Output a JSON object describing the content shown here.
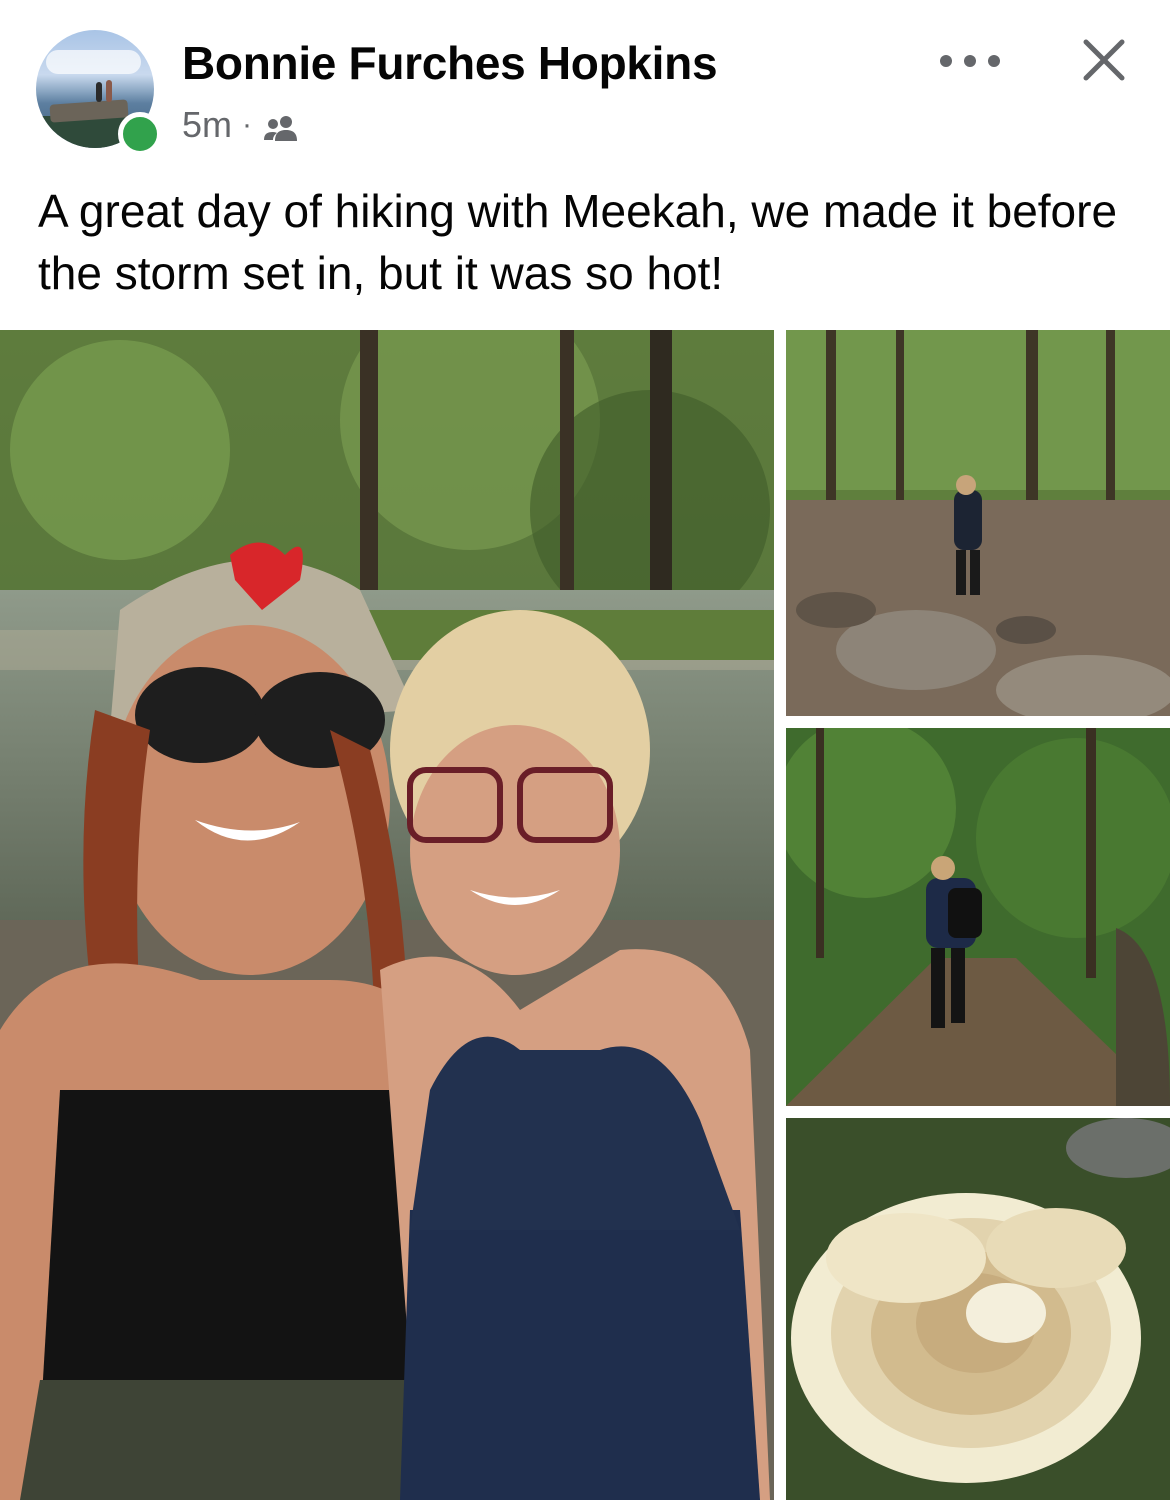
{
  "post": {
    "author": "Bonnie Furches Hopkins",
    "time": "5m",
    "separator": "·",
    "audience_icon": "friends-icon",
    "online": true,
    "caption": "A great day of hiking with Meekah, we made it before the storm set in, but it was so hot!"
  },
  "actions": {
    "more_icon": "more-options-icon",
    "close_icon": "close-icon"
  },
  "photos": [
    {
      "id": "selfie",
      "icon": "photo"
    },
    {
      "id": "rocky-creek-trail",
      "icon": "photo"
    },
    {
      "id": "forest-path",
      "icon": "photo"
    },
    {
      "id": "mushroom",
      "icon": "photo"
    }
  ],
  "colors": {
    "online": "#31a24c",
    "secondary_text": "#65676b",
    "primary_text": "#050505"
  }
}
